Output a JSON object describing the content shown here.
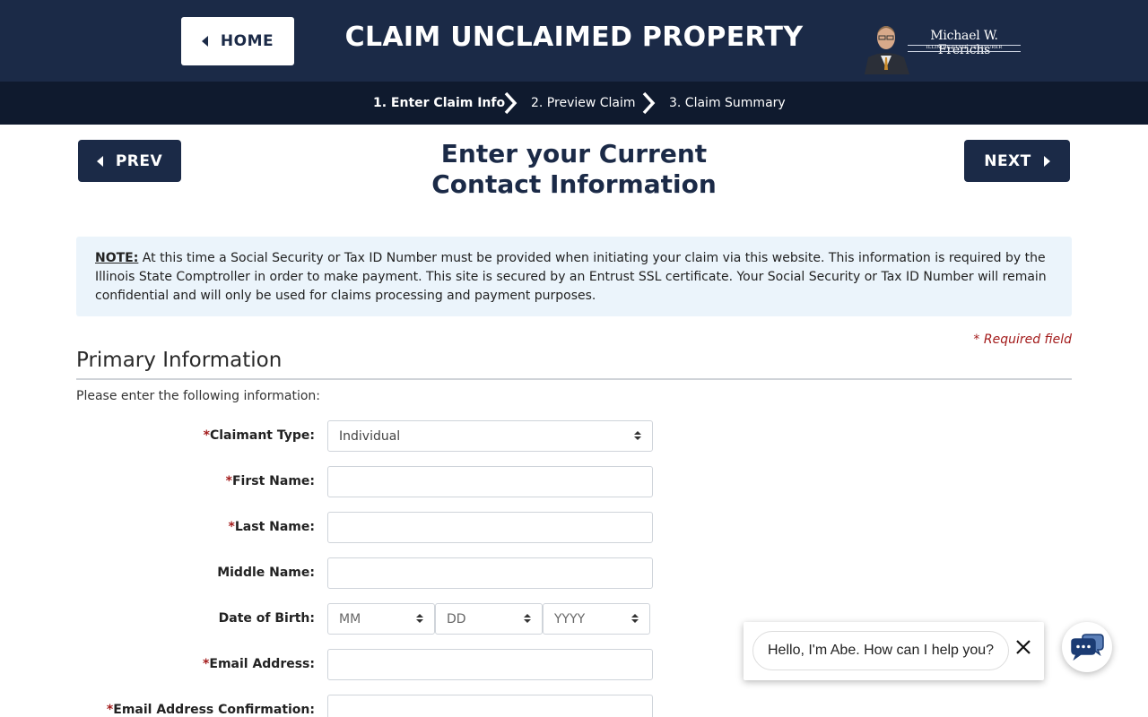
{
  "header": {
    "home_label": "HOME",
    "title": "CLAIM UNCLAIMED PROPERTY",
    "logo_name": "Michael W. Frerichs",
    "logo_subtitle": "ILLINOIS STATE TREASURER"
  },
  "steps": [
    {
      "label": "1. Enter Claim Info",
      "active": true
    },
    {
      "label": "2. Preview Claim",
      "active": false
    },
    {
      "label": "3. Claim Summary",
      "active": false
    }
  ],
  "nav": {
    "prev_label": "PREV",
    "next_label": "NEXT"
  },
  "page_heading_line1": "Enter your Current",
  "page_heading_line2": "Contact Information",
  "note": {
    "label": "NOTE:",
    "text": " At this time a Social Security or Tax ID Number must be provided when initiating your claim via this website. This information is required by the Illinois State Comptroller in order to make payment. This site is secured by an Entrust SSL certificate. Your Social Security or Tax ID Number will remain confidential and will only be used for claims processing and payment purposes."
  },
  "required_note": "* Required field",
  "section": {
    "title": "Primary Information",
    "instructions": "Please enter the following information:"
  },
  "fields": {
    "claimant_type": {
      "label": "Claimant Type:",
      "required_marker": "*",
      "value": "Individual"
    },
    "first_name": {
      "label": "First Name:",
      "required_marker": "*",
      "value": ""
    },
    "last_name": {
      "label": "Last Name:",
      "required_marker": "*",
      "value": ""
    },
    "middle_name": {
      "label": "Middle Name:",
      "value": ""
    },
    "dob": {
      "label": "Date of Birth:",
      "month": "MM",
      "day": "DD",
      "year": "YYYY"
    },
    "email": {
      "label": "Email Address:",
      "required_marker": "*",
      "value": ""
    },
    "email_confirm": {
      "label": "Email Address Confirmation:",
      "required_marker": "*",
      "value": ""
    }
  },
  "chat": {
    "greeting": "Hello, I'm Abe. How can I help you?"
  },
  "colors": {
    "navy": "#1b2a47",
    "step_bar": "#0f1a2e",
    "note_bg": "#ebf4fb",
    "required_red": "#a31b1b"
  }
}
